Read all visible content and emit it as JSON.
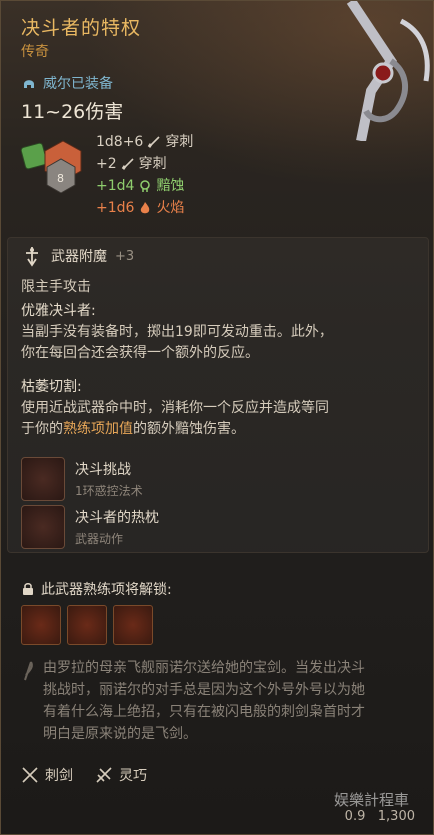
{
  "item": {
    "name": "决斗者的特权",
    "rarity": "传奇",
    "equipped_by": "威尔已装备",
    "damage": "11~26伤害",
    "damage_lines": [
      {
        "formula": "1d8+6",
        "type": "穿刺",
        "color": "#d8cfc1"
      },
      {
        "formula": "+2",
        "type": "穿刺",
        "color": "#d8cfc1"
      },
      {
        "formula": "+1d4",
        "type": "黯蚀",
        "color": "#8fce6e"
      },
      {
        "formula": "+1d6",
        "type": "火焰",
        "color": "#e9814a"
      }
    ],
    "dice_label": "8"
  },
  "enchant": {
    "name": "武器附魔",
    "bonus": "+3",
    "restriction": "限主手攻击",
    "feature1_title": "优雅决斗者:",
    "feature1_text1": "当副手没有装备时，掷出19即可发动重击。此外，",
    "feature1_text2": "你在每回合还会获得一个额外的反应。",
    "feature2_title": "枯萎切割:",
    "feature2_text1": "使用近战武器命中时，消耗你一个反应并造成等同",
    "feature2_text2_a": "于你的",
    "feature2_text2_hl": "熟练项加值",
    "feature2_text2_b": "的额外黯蚀伤害。"
  },
  "actions": [
    {
      "name": "决斗挑战",
      "type": "1环惑控法术",
      "icon": "duel-challenge-icon"
    },
    {
      "name": "决斗者的热枕",
      "type": "武器动作",
      "icon": "duellists-zeal-icon"
    }
  ],
  "mastery": {
    "title": "此武器熟练项将解锁:",
    "icons": [
      "mastery-action-1-icon",
      "mastery-action-2-icon",
      "mastery-action-3-icon"
    ]
  },
  "lore": {
    "line1": "由罗拉的母亲飞舰丽诺尔送给她的宝剑。当发出决斗",
    "line2": "挑战时，丽诺尔的对手总是因为这个外号外号以为她",
    "line3": "有着什么海上绝招，只有在被闪电般的刺剑枭首时才",
    "line4": "明白是原来说的是飞剑。"
  },
  "footer": {
    "weapon_type": "刺剑",
    "property": "灵巧",
    "weight": "0.9",
    "price": "1,300"
  },
  "watermark": "娱樂計程車"
}
